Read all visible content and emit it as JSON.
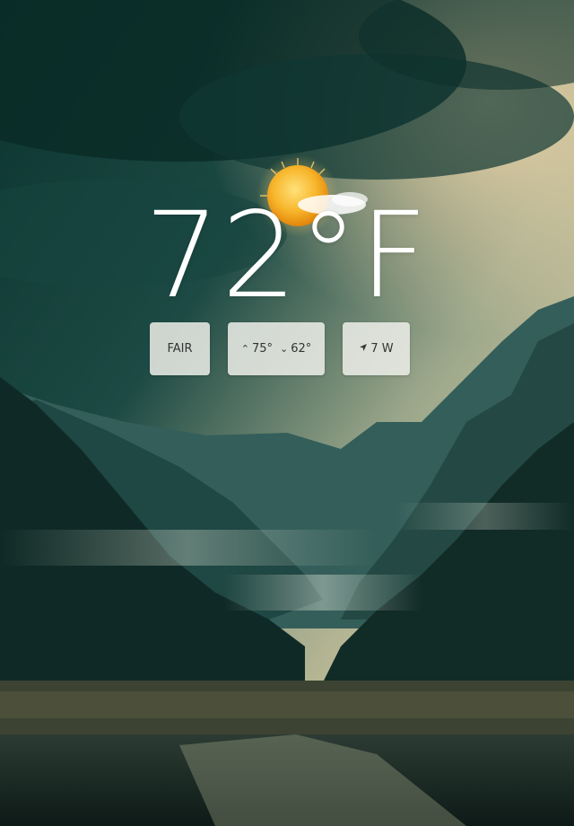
{
  "weather": {
    "temperature": "72°F",
    "condition_icon": "sunny-icon",
    "condition": "FAIR",
    "high": "75°",
    "low": "62°",
    "wind": "7 W"
  },
  "icons": {
    "high": "caret-up-icon",
    "low": "caret-down-icon",
    "wind": "navigation-arrow-icon"
  },
  "colors": {
    "sky_dark": "#0e3a34",
    "sky_light": "#e9d3a8",
    "chip_bg": "#eceee8",
    "text_white": "#ffffff"
  }
}
